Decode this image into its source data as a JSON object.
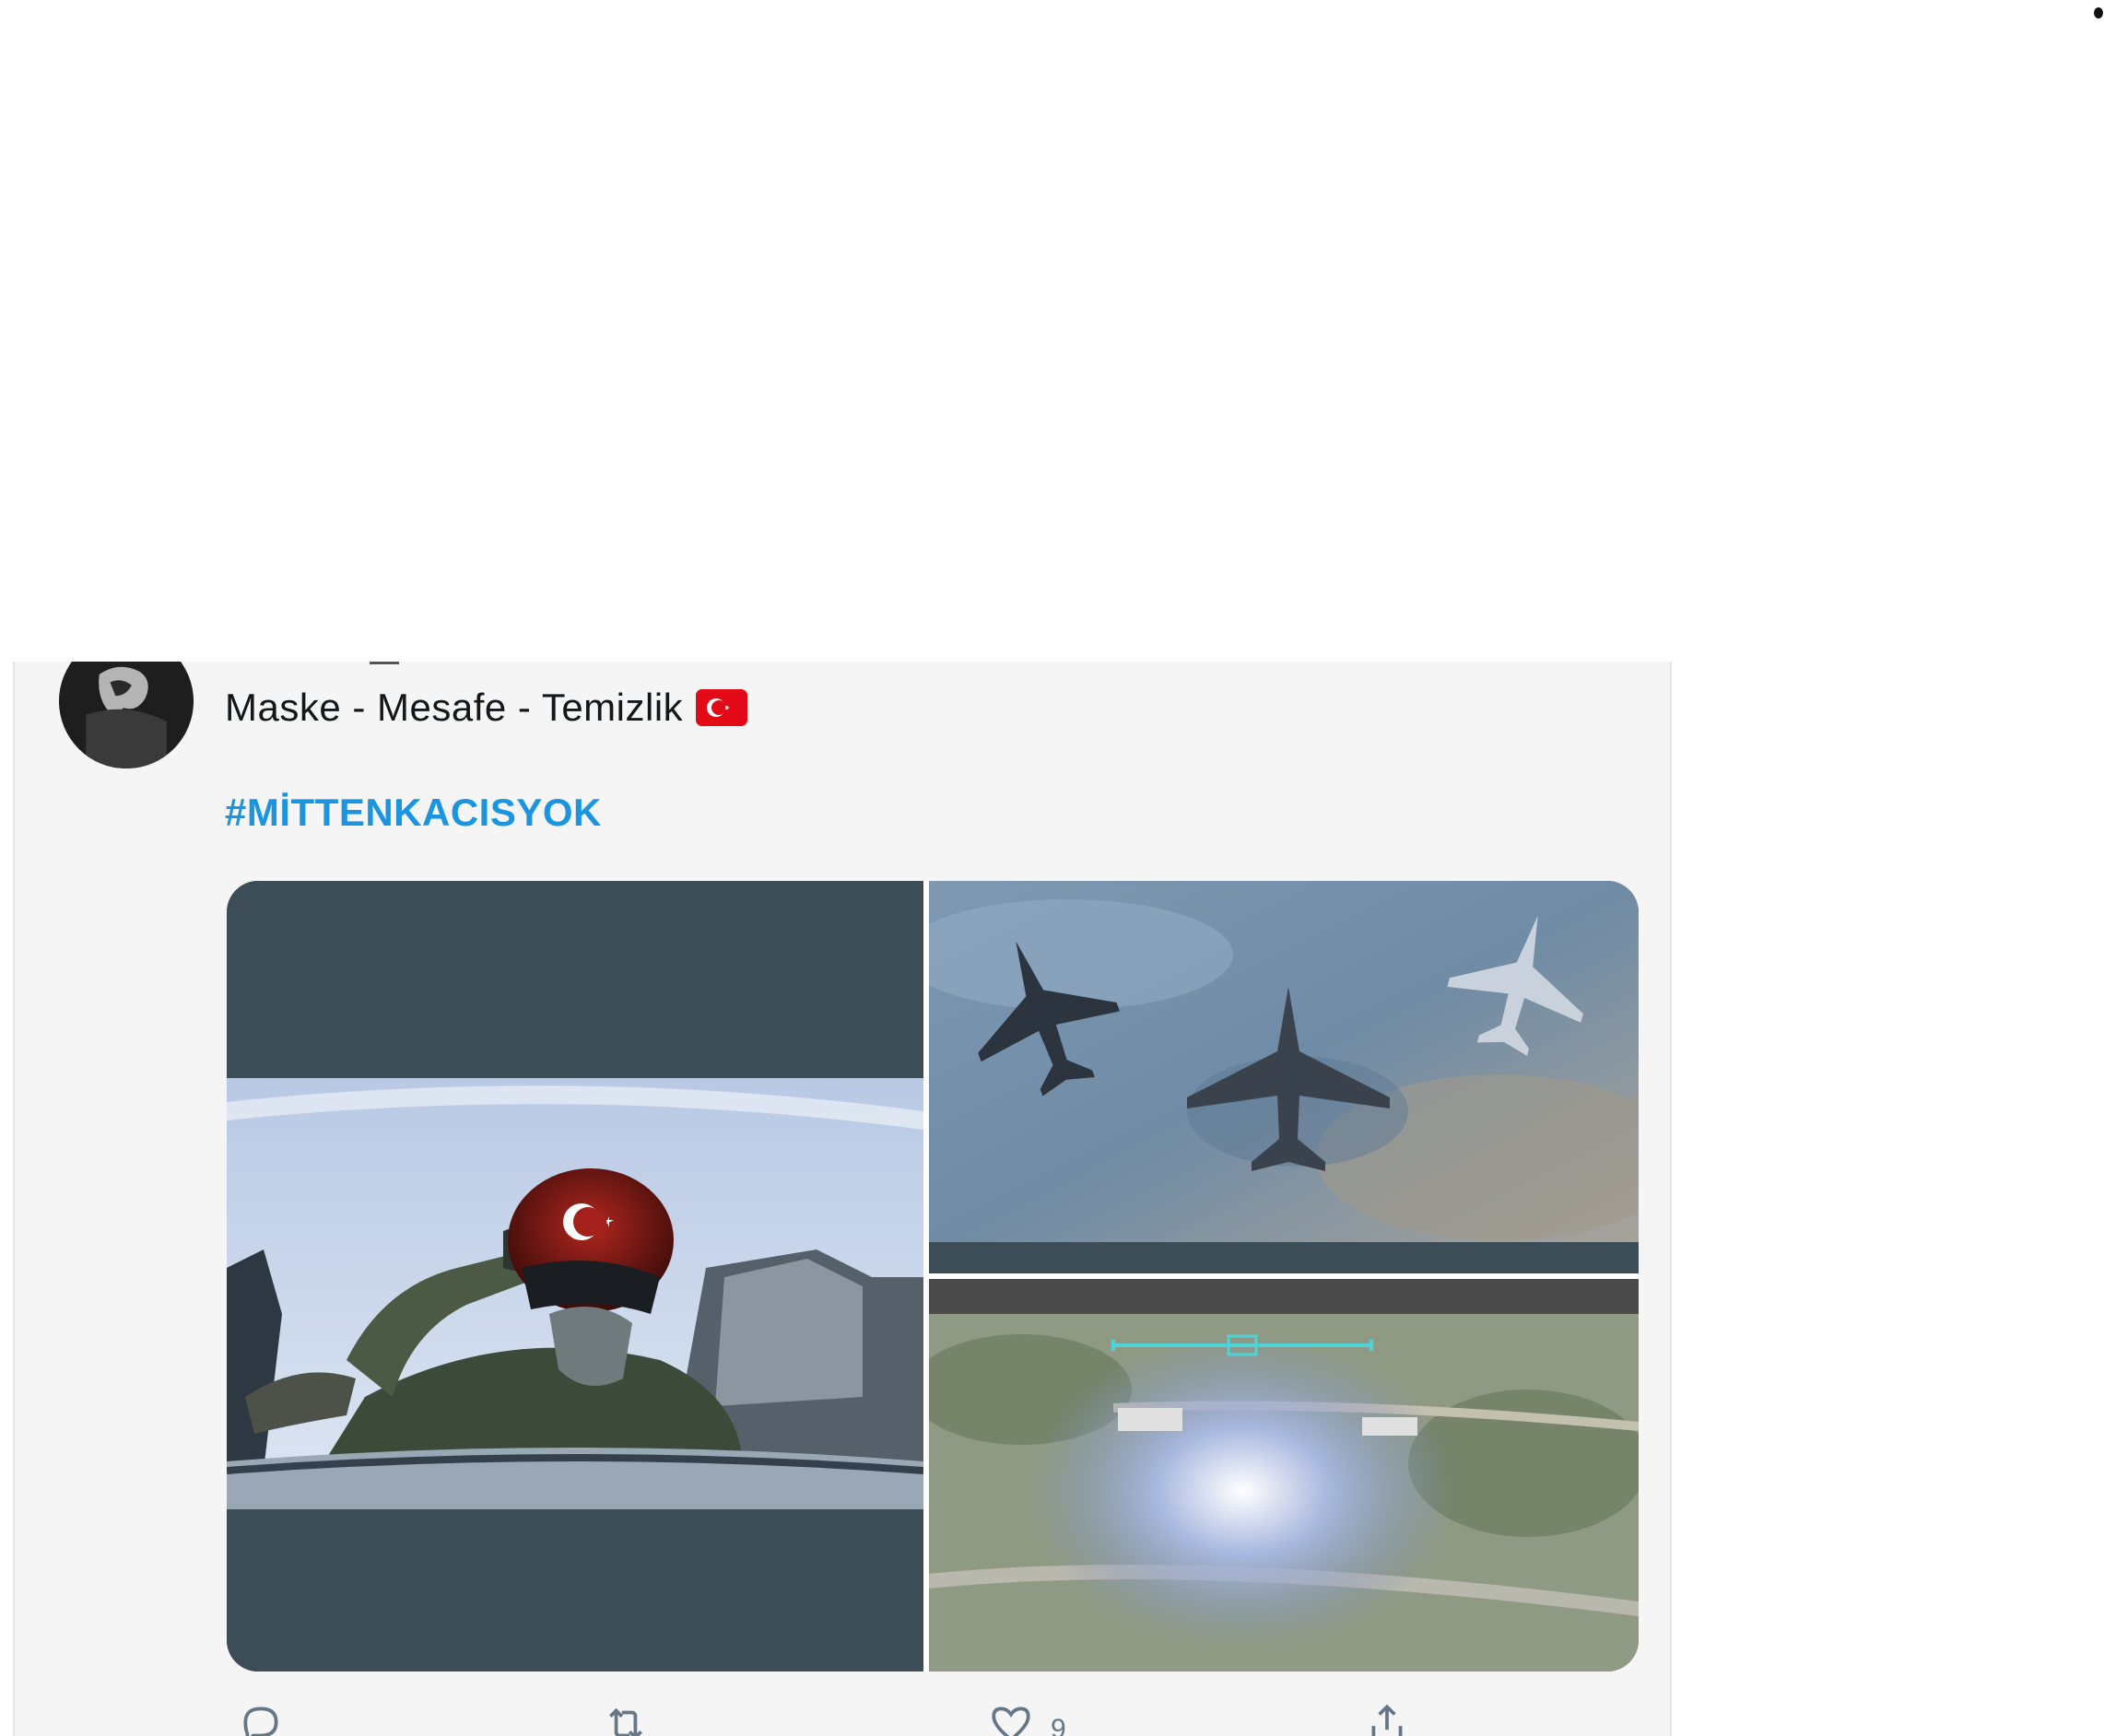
{
  "tweet": {
    "text": "Maske - Mesafe - Temizlik",
    "flag_icon": "turkey-flag-emoji",
    "hashtag": "#MİTTENKACISYOK",
    "media": [
      {
        "name": "pilot-saluting-photo"
      },
      {
        "name": "fighter-jets-formation-photo"
      },
      {
        "name": "aerial-strike-photo"
      }
    ],
    "actions": {
      "reply": {
        "icon": "reply-icon",
        "count": ""
      },
      "retweet": {
        "icon": "retweet-icon",
        "count": ""
      },
      "like": {
        "icon": "heart-icon",
        "count": "9"
      },
      "share": {
        "icon": "share-icon",
        "count": ""
      }
    }
  },
  "colors": {
    "card_background": "#f5f5f5",
    "hashtag": "#1b95e0",
    "text": "#14171a",
    "muted": "#657786",
    "flag_red": "#e30a17"
  }
}
